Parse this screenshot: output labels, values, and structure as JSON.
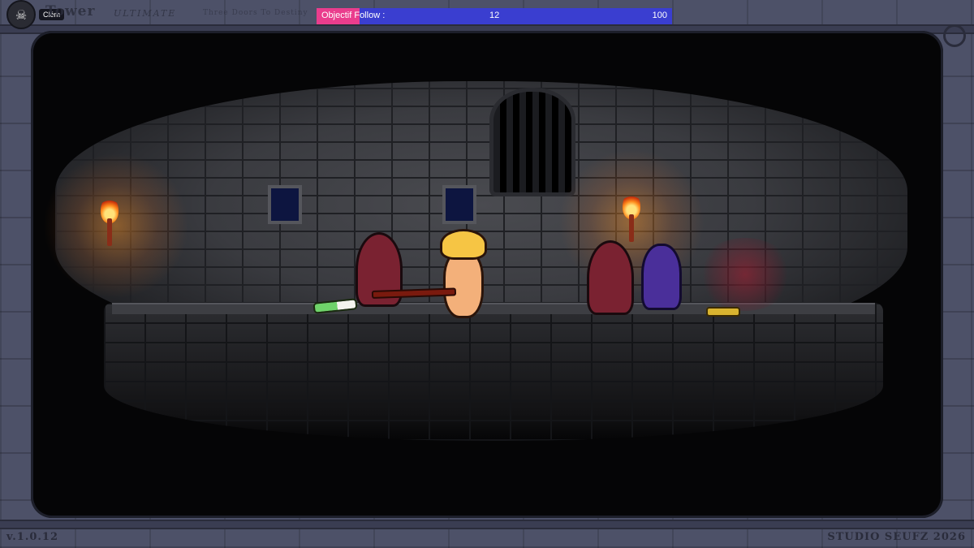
{
  "header": {
    "username": "Clém",
    "title": "Tower",
    "subtitle": "ULTIMATE",
    "tagline": "Three Doors To Destiny"
  },
  "objective": {
    "label": "Objectif Follow :",
    "current": "12",
    "target": "100",
    "progress_fraction": 0.12,
    "fill_color": "#ea3d8d",
    "track_color": "#3a3ed0"
  },
  "footer": {
    "version": "v.1.0.12",
    "studio": "STUDIO SEUFZ 2026"
  },
  "scene": {
    "icons": [
      "torch-icon",
      "grate-icon",
      "hero-icon",
      "cultist-icon",
      "goblin-icon",
      "leek-icon",
      "coins-icon"
    ]
  }
}
